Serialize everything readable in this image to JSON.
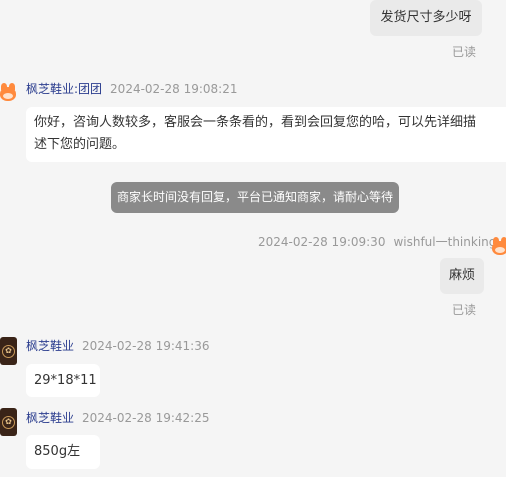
{
  "messages": {
    "m1": {
      "text": "发货尺寸多少呀",
      "status": "已读"
    },
    "m2": {
      "sender": "枫芝鞋业:团团",
      "time": "2024-02-28 19:08:21",
      "line1": "你好，咨询人数较多，客服会一条条看的，看到会回复您的哈，可以先详细描",
      "line2": "述下您的问题。"
    },
    "system": {
      "text": "商家长时间没有回复，平台已通知商家，请耐心等待"
    },
    "m3": {
      "time": "2024-02-28 19:09:30",
      "sender": "wishful一thinking",
      "text": "麻烦",
      "status": "已读"
    },
    "m4": {
      "sender": "枫芝鞋业",
      "time": "2024-02-28 19:41:36",
      "text": "29*18*11"
    },
    "m5": {
      "sender": "枫芝鞋业",
      "time": "2024-02-28 19:42:25",
      "text": "850g左右"
    }
  },
  "icons": {
    "shop_avatar": "shop-logo-icon",
    "service_avatar": "customer-service-mascot-icon",
    "user_avatar": "user-mascot-icon"
  }
}
